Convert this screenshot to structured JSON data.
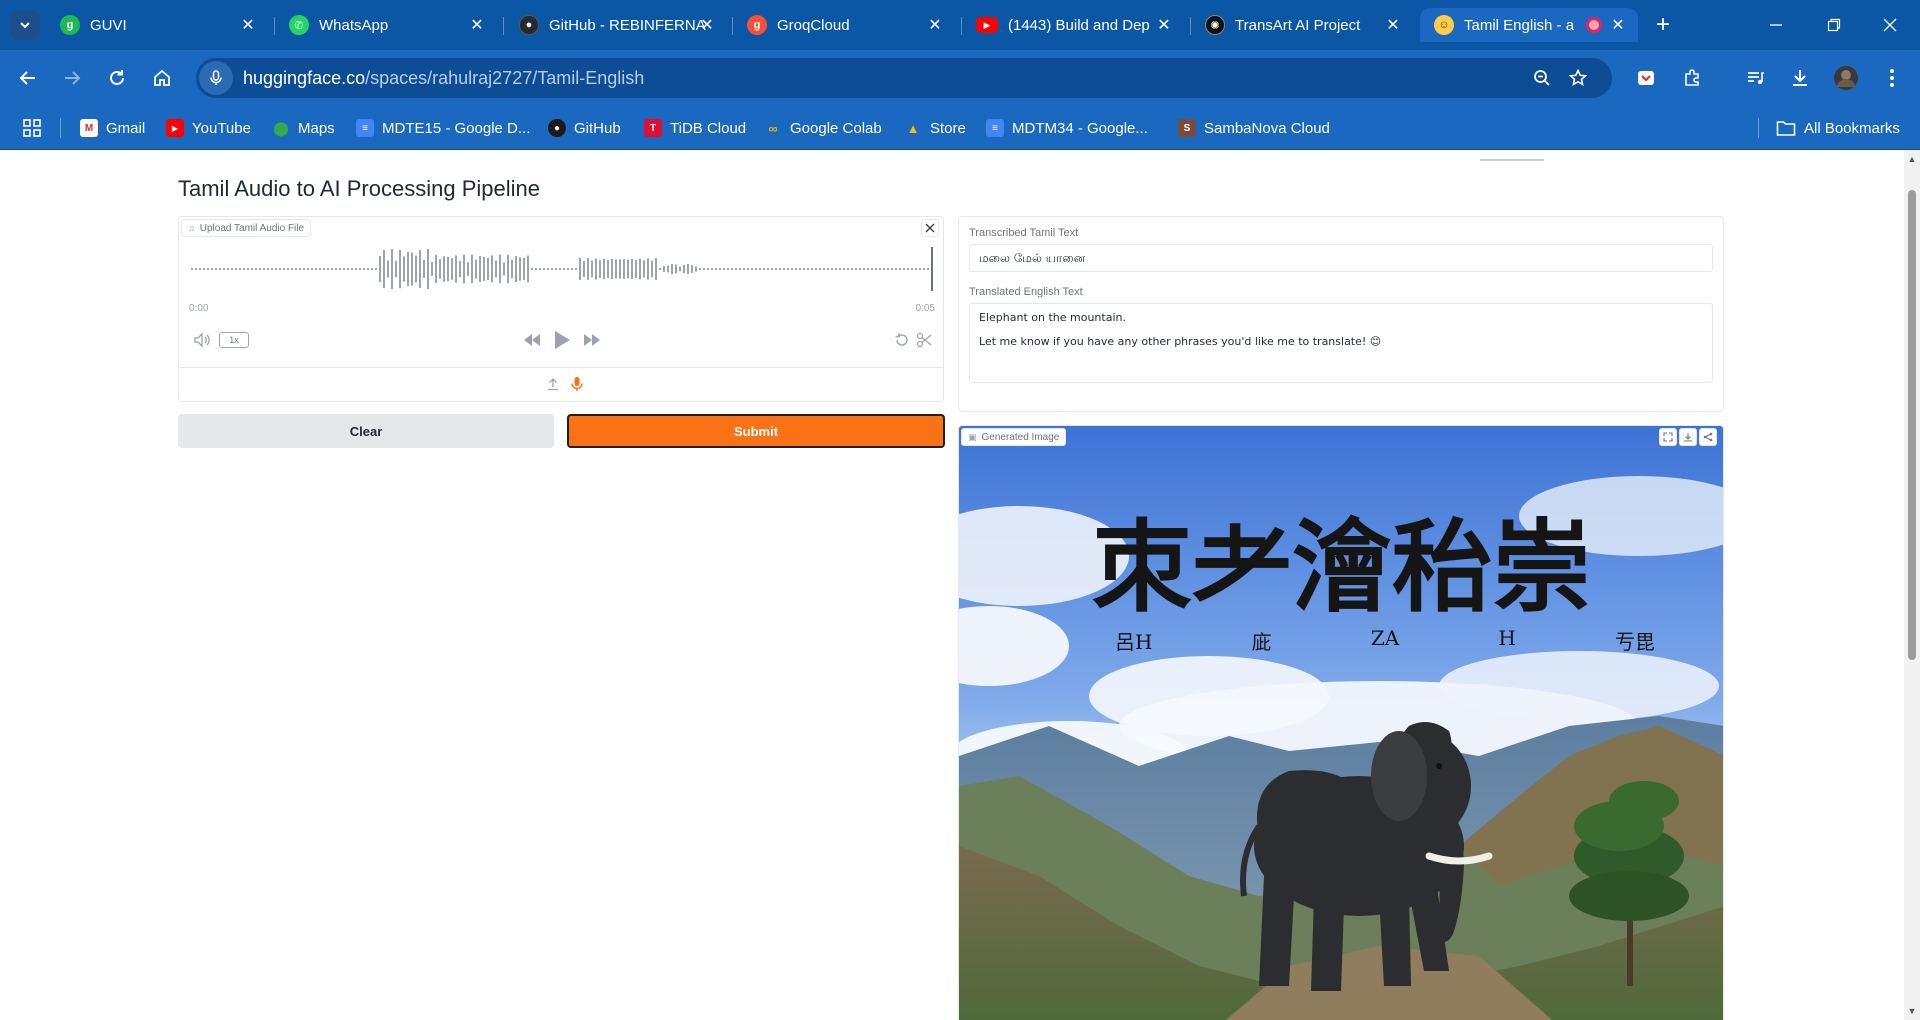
{
  "browser": {
    "tabs": [
      {
        "title": "GUVI",
        "favicon": "guvi-favicon",
        "color": "#1db954"
      },
      {
        "title": "WhatsApp",
        "favicon": "whatsapp-favicon",
        "color": "#25d366"
      },
      {
        "title": "GitHub - REBINFERNA",
        "favicon": "github-favicon",
        "color": "#24292e"
      },
      {
        "title": "GroqCloud",
        "favicon": "groq-favicon",
        "color": "#f55036"
      },
      {
        "title": "(1443) Build and Dep",
        "favicon": "youtube-favicon",
        "color": "#ff0000"
      },
      {
        "title": "TransArt AI Project",
        "favicon": "openai-favicon",
        "color": "#111111"
      },
      {
        "title": "Tamil English - a",
        "favicon": "huggingface-favicon",
        "color": "#ffcc4d"
      }
    ],
    "url_host": "huggingface.co",
    "url_path": "/spaces/rahulraj2727/Tamil-English",
    "bookmarks": [
      {
        "label": "Gmail",
        "icon": "gmail-icon"
      },
      {
        "label": "YouTube",
        "icon": "youtube-icon"
      },
      {
        "label": "Maps",
        "icon": "maps-icon"
      },
      {
        "label": "MDTE15 - Google D...",
        "icon": "docs-icon"
      },
      {
        "label": "GitHub",
        "icon": "github-icon"
      },
      {
        "label": "TiDB Cloud",
        "icon": "tidb-icon"
      },
      {
        "label": "Google Colab",
        "icon": "colab-icon"
      },
      {
        "label": "Store",
        "icon": "store-icon"
      },
      {
        "label": "MDTM34 - Google...",
        "icon": "docs-icon"
      },
      {
        "label": "SambaNova Cloud",
        "icon": "sambanova-icon"
      }
    ],
    "all_bookmarks": "All Bookmarks"
  },
  "app": {
    "title": "Tamil Audio to AI Processing Pipeline",
    "audio": {
      "label": "Upload Tamil Audio File",
      "time_start": "0:00",
      "time_end": "0:05",
      "speed": "1x"
    },
    "buttons": {
      "clear": "Clear",
      "submit": "Submit"
    },
    "transcribed": {
      "label": "Transcribed Tamil Text",
      "value": "மலை மேல் யானை"
    },
    "translated": {
      "label": "Translated English Text",
      "value": "Elephant on the mountain.\n\nLet me know if you have any other phrases you'd like me to translate! 😊"
    },
    "image": {
      "label": "Generated Image",
      "headline": "朿耂澮秮崇",
      "subline": [
        "呂H",
        "庛",
        "ZA",
        "H",
        "亐毘"
      ]
    }
  },
  "colors": {
    "chrome_dark": "#0b57a5",
    "chrome": "#1a68bf",
    "submit": "#f97316",
    "clear": "#e5e7eb"
  }
}
